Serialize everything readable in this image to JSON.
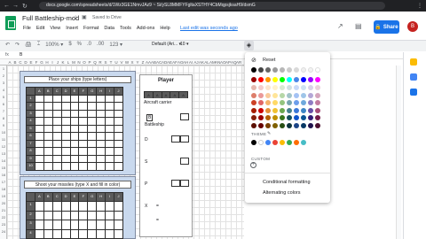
{
  "browser": {
    "url": "docs.google.com/spreadsheets/d/1Wz3GE1NmvJAz9 ~ Si/ySL8MMFYFgltaXSTHY4CbMqpsjksaH9/dsmG",
    "nav_back": "←",
    "nav_forward": "→",
    "reload": "↻",
    "ext": "⋮"
  },
  "header": {
    "title": "Full Battleship-mod",
    "star": "☆",
    "folder": "▣",
    "saved": "Saved to Drive",
    "last_edit": "Last edit was seconds ago",
    "share_label": "Share",
    "avatar": "B",
    "trend_icon": "↗",
    "comment_icon": "▤"
  },
  "menu": [
    "File",
    "Edit",
    "View",
    "Insert",
    "Format",
    "Data",
    "Tools",
    "Add-ons",
    "Help"
  ],
  "toolbar": {
    "icons": [
      "↶",
      "↷",
      "🖨",
      "⌶",
      "100% ▾",
      "$",
      "%",
      ".0",
      ".00",
      "123 ▾"
    ],
    "font": "Default (Ari... ▾",
    "size": "10 ▾",
    "fill_icon": "◈"
  },
  "formula": {
    "fx": "fx",
    "value": "B"
  },
  "columns": [
    "A",
    "B",
    "C",
    "D",
    "E",
    "F",
    "G",
    "H",
    "I",
    "J",
    "K",
    "L",
    "M",
    "N",
    "O",
    "P",
    "Q",
    "R",
    "S",
    "T",
    "U",
    "V",
    "W",
    "X",
    "Y",
    "Z",
    "AA",
    "AB",
    "AC",
    "AD",
    "AE",
    "AF",
    "AG",
    "AH",
    "AI",
    "AJ",
    "AK",
    "AL",
    "AM",
    "AN",
    "AO",
    "AP",
    "AQ",
    "AR"
  ],
  "rows": [
    "1",
    "2",
    "3",
    "4",
    "5",
    "6",
    "7",
    "8",
    "9",
    "10",
    "11",
    "12",
    "13",
    "14",
    "15",
    "16",
    "17",
    "18",
    "19",
    "20",
    "21",
    "22",
    "23",
    "24",
    "25"
  ],
  "board1": {
    "title": "Place your ships (type letters)",
    "header": [
      "A",
      "B",
      "C",
      "D",
      "E",
      "F",
      "G",
      "H",
      "I",
      "J"
    ],
    "labels": [
      "1",
      "2",
      "3",
      "4",
      "5",
      "6",
      "7",
      "8",
      "9",
      "10"
    ]
  },
  "board2": {
    "title": "Shoot your missiles (type X and fill in color)",
    "header": [
      "A",
      "B",
      "C",
      "D",
      "E",
      "F",
      "G",
      "H",
      "I",
      "J"
    ],
    "labels": [
      "1",
      "2",
      "3",
      "4"
    ]
  },
  "player": {
    "title": "Player",
    "header": [
      "A",
      "A",
      "A",
      "A",
      "A"
    ],
    "aircraft": "Aircraft carrier",
    "b_label": "B",
    "battleship": "Battleship",
    "d_label": "D",
    "s_label": "S",
    "p_label": "P",
    "x_label": "X",
    "eq": "=",
    "eq2": "="
  },
  "palette": {
    "reset": "Reset",
    "reset_icon": "⊘",
    "theme": "THEME",
    "pen_icon": "✎",
    "custom": "CUSTOM",
    "add_custom": "+",
    "conditional": "Conditional formatting",
    "alternating": "Alternating colors",
    "rows": [
      [
        "#000000",
        "#434343",
        "#666666",
        "#999999",
        "#b7b7b7",
        "#cccccc",
        "#d9d9d9",
        "#efefef",
        "#f3f3f3",
        "#ffffff"
      ],
      [
        "#980000",
        "#ff0000",
        "#ff9900",
        "#ffff00",
        "#00ff00",
        "#00ffff",
        "#4a86e8",
        "#0000ff",
        "#9900ff",
        "#ff00ff"
      ],
      [
        "#e6b8af",
        "#f4cccc",
        "#fce5cd",
        "#fff2cc",
        "#d9ead3",
        "#d0e0e3",
        "#c9daf8",
        "#cfe2f3",
        "#d9d2e9",
        "#ead1dc"
      ],
      [
        "#dd7e6b",
        "#ea9999",
        "#f9cb9c",
        "#ffe599",
        "#b6d7a8",
        "#a2c4c9",
        "#a4c2f4",
        "#9fc5e8",
        "#b4a7d6",
        "#d5a6bd"
      ],
      [
        "#cc4125",
        "#e06666",
        "#f6b26b",
        "#ffd966",
        "#93c47d",
        "#76a5af",
        "#6d9eeb",
        "#6fa8dc",
        "#8e7cc3",
        "#c27ba0"
      ],
      [
        "#a61c00",
        "#cc0000",
        "#e69138",
        "#f1c232",
        "#6aa84f",
        "#45818e",
        "#3c78d8",
        "#3d85c6",
        "#674ea7",
        "#a64d79"
      ],
      [
        "#85200c",
        "#990000",
        "#b45f06",
        "#bf9000",
        "#38761d",
        "#134f5c",
        "#1155cc",
        "#0b5394",
        "#351c75",
        "#741b47"
      ],
      [
        "#5b0f00",
        "#660000",
        "#783f04",
        "#7f6000",
        "#274e13",
        "#0c343d",
        "#1c4587",
        "#073763",
        "#20124d",
        "#4c1130"
      ]
    ],
    "theme_colors": [
      "#000000",
      "#ffffff",
      "#4285f4",
      "#ea4335",
      "#fbbc04",
      "#34a853",
      "#ff6d01",
      "#46bdc6"
    ]
  },
  "side_icons": [
    "#fbbc04",
    "#4285f4",
    "#1a73e8"
  ]
}
